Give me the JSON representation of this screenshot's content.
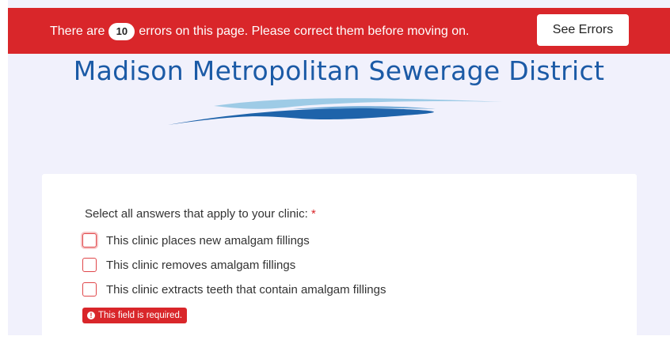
{
  "banner": {
    "prefix": "There are",
    "error_count": "10",
    "suffix": "errors on this page. Please correct them before moving on.",
    "button_label": "See Errors"
  },
  "logo": {
    "title": "Madison Metropolitan Sewerage District"
  },
  "form": {
    "question": "Select all answers that apply to your clinic:",
    "required_mark": "*",
    "options": [
      {
        "label": "This clinic places new amalgam fillings",
        "checked": false
      },
      {
        "label": "This clinic removes amalgam fillings",
        "checked": false
      },
      {
        "label": "This clinic extracts teeth that contain amalgam fillings",
        "checked": false
      }
    ],
    "error_icon": "!",
    "error_message": "This field is required."
  },
  "colors": {
    "error_red": "#d9262a",
    "brand_blue": "#1b5aa6",
    "page_background": "#f1f1fc"
  }
}
